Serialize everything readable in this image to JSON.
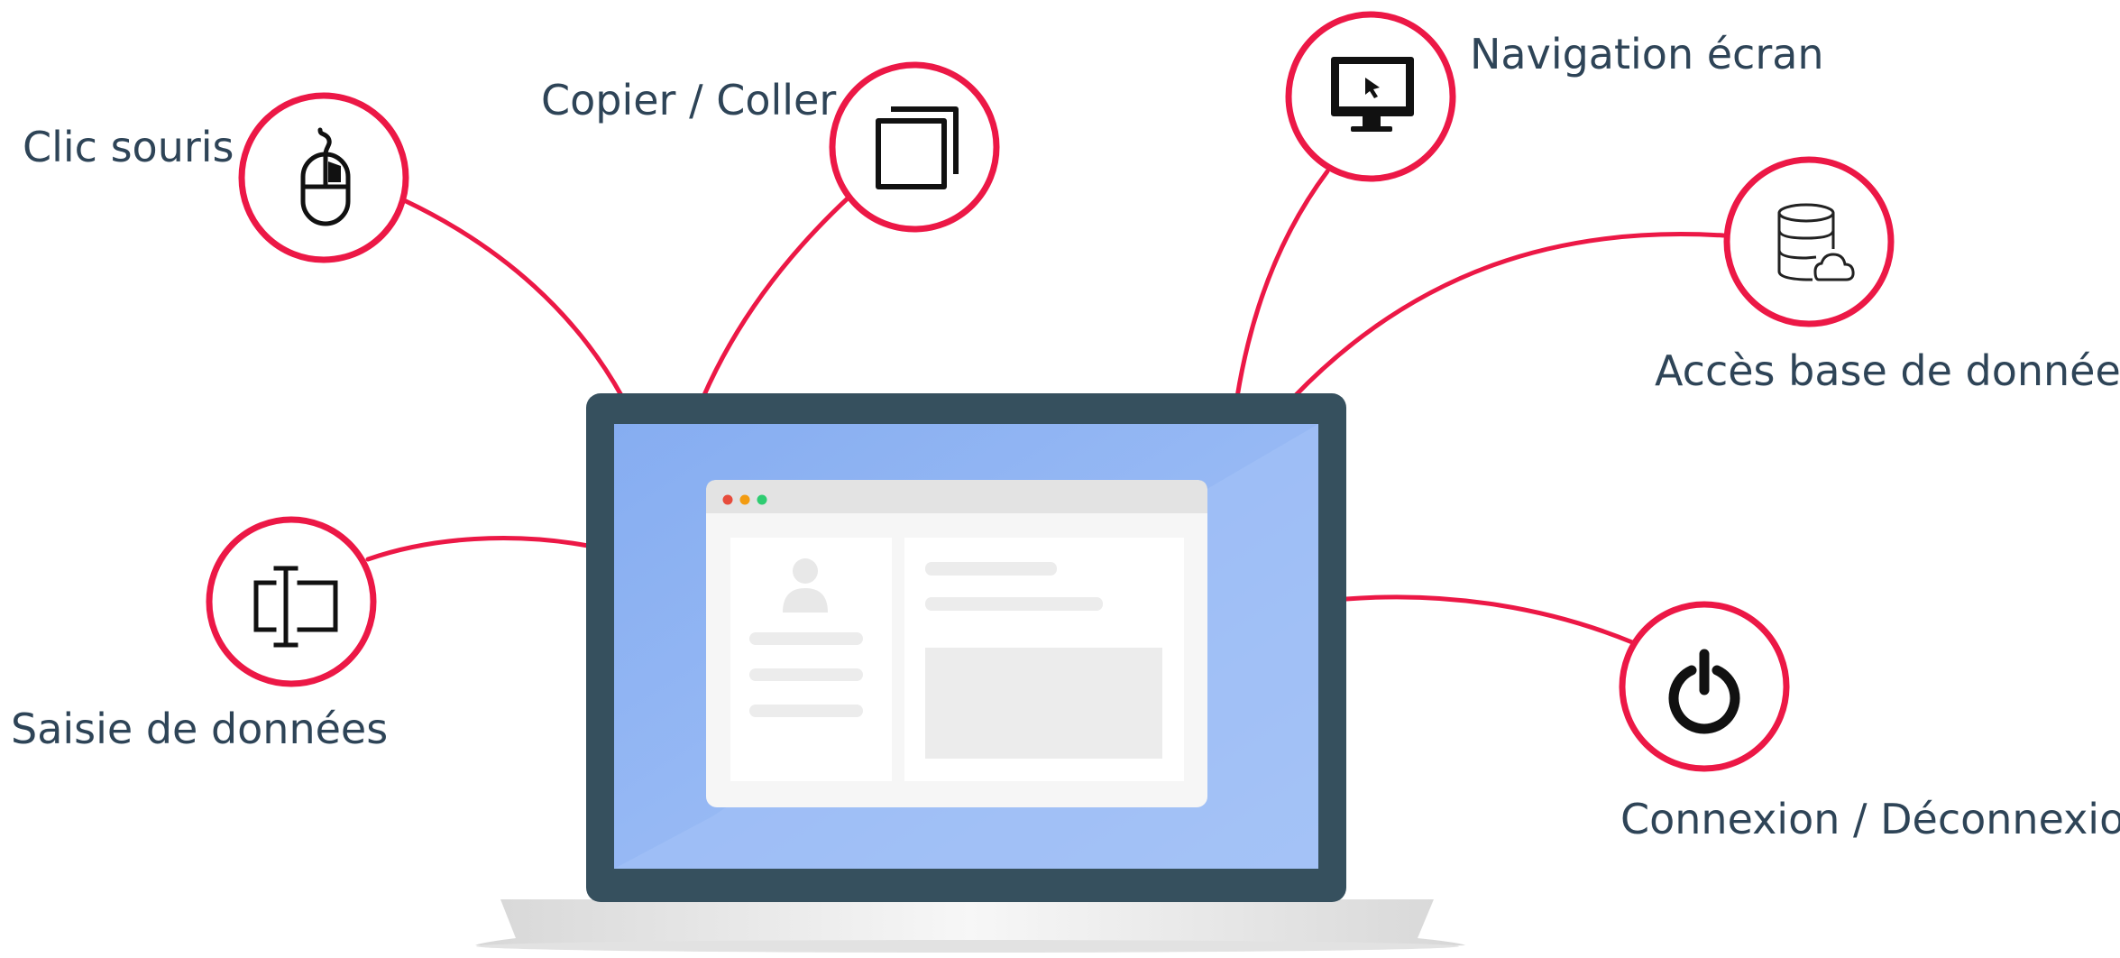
{
  "features": [
    {
      "id": "mouse",
      "label": "Clic souris",
      "icon": "mouse-icon"
    },
    {
      "id": "copy",
      "label": "Copier / Coller",
      "icon": "copy-paste-icon"
    },
    {
      "id": "screen",
      "label": "Navigation écran",
      "icon": "monitor-cursor-icon"
    },
    {
      "id": "database",
      "label": "Accès base de données",
      "icon": "database-cloud-icon"
    },
    {
      "id": "input",
      "label": "Saisie de données",
      "icon": "text-input-icon"
    },
    {
      "id": "power",
      "label": "Connexion / Déconnexion",
      "icon": "power-icon"
    }
  ],
  "colors": {
    "accent": "#ec1846",
    "label_text": "#2e4457",
    "laptop_bezel": "#36505e",
    "screen_blue": "#8fb4f2",
    "window_chrome": "#e4e4e4",
    "window_body": "#f6f6f6",
    "dot_red": "#e74c3c",
    "dot_orange": "#f39c12",
    "dot_green": "#2ecc71"
  }
}
